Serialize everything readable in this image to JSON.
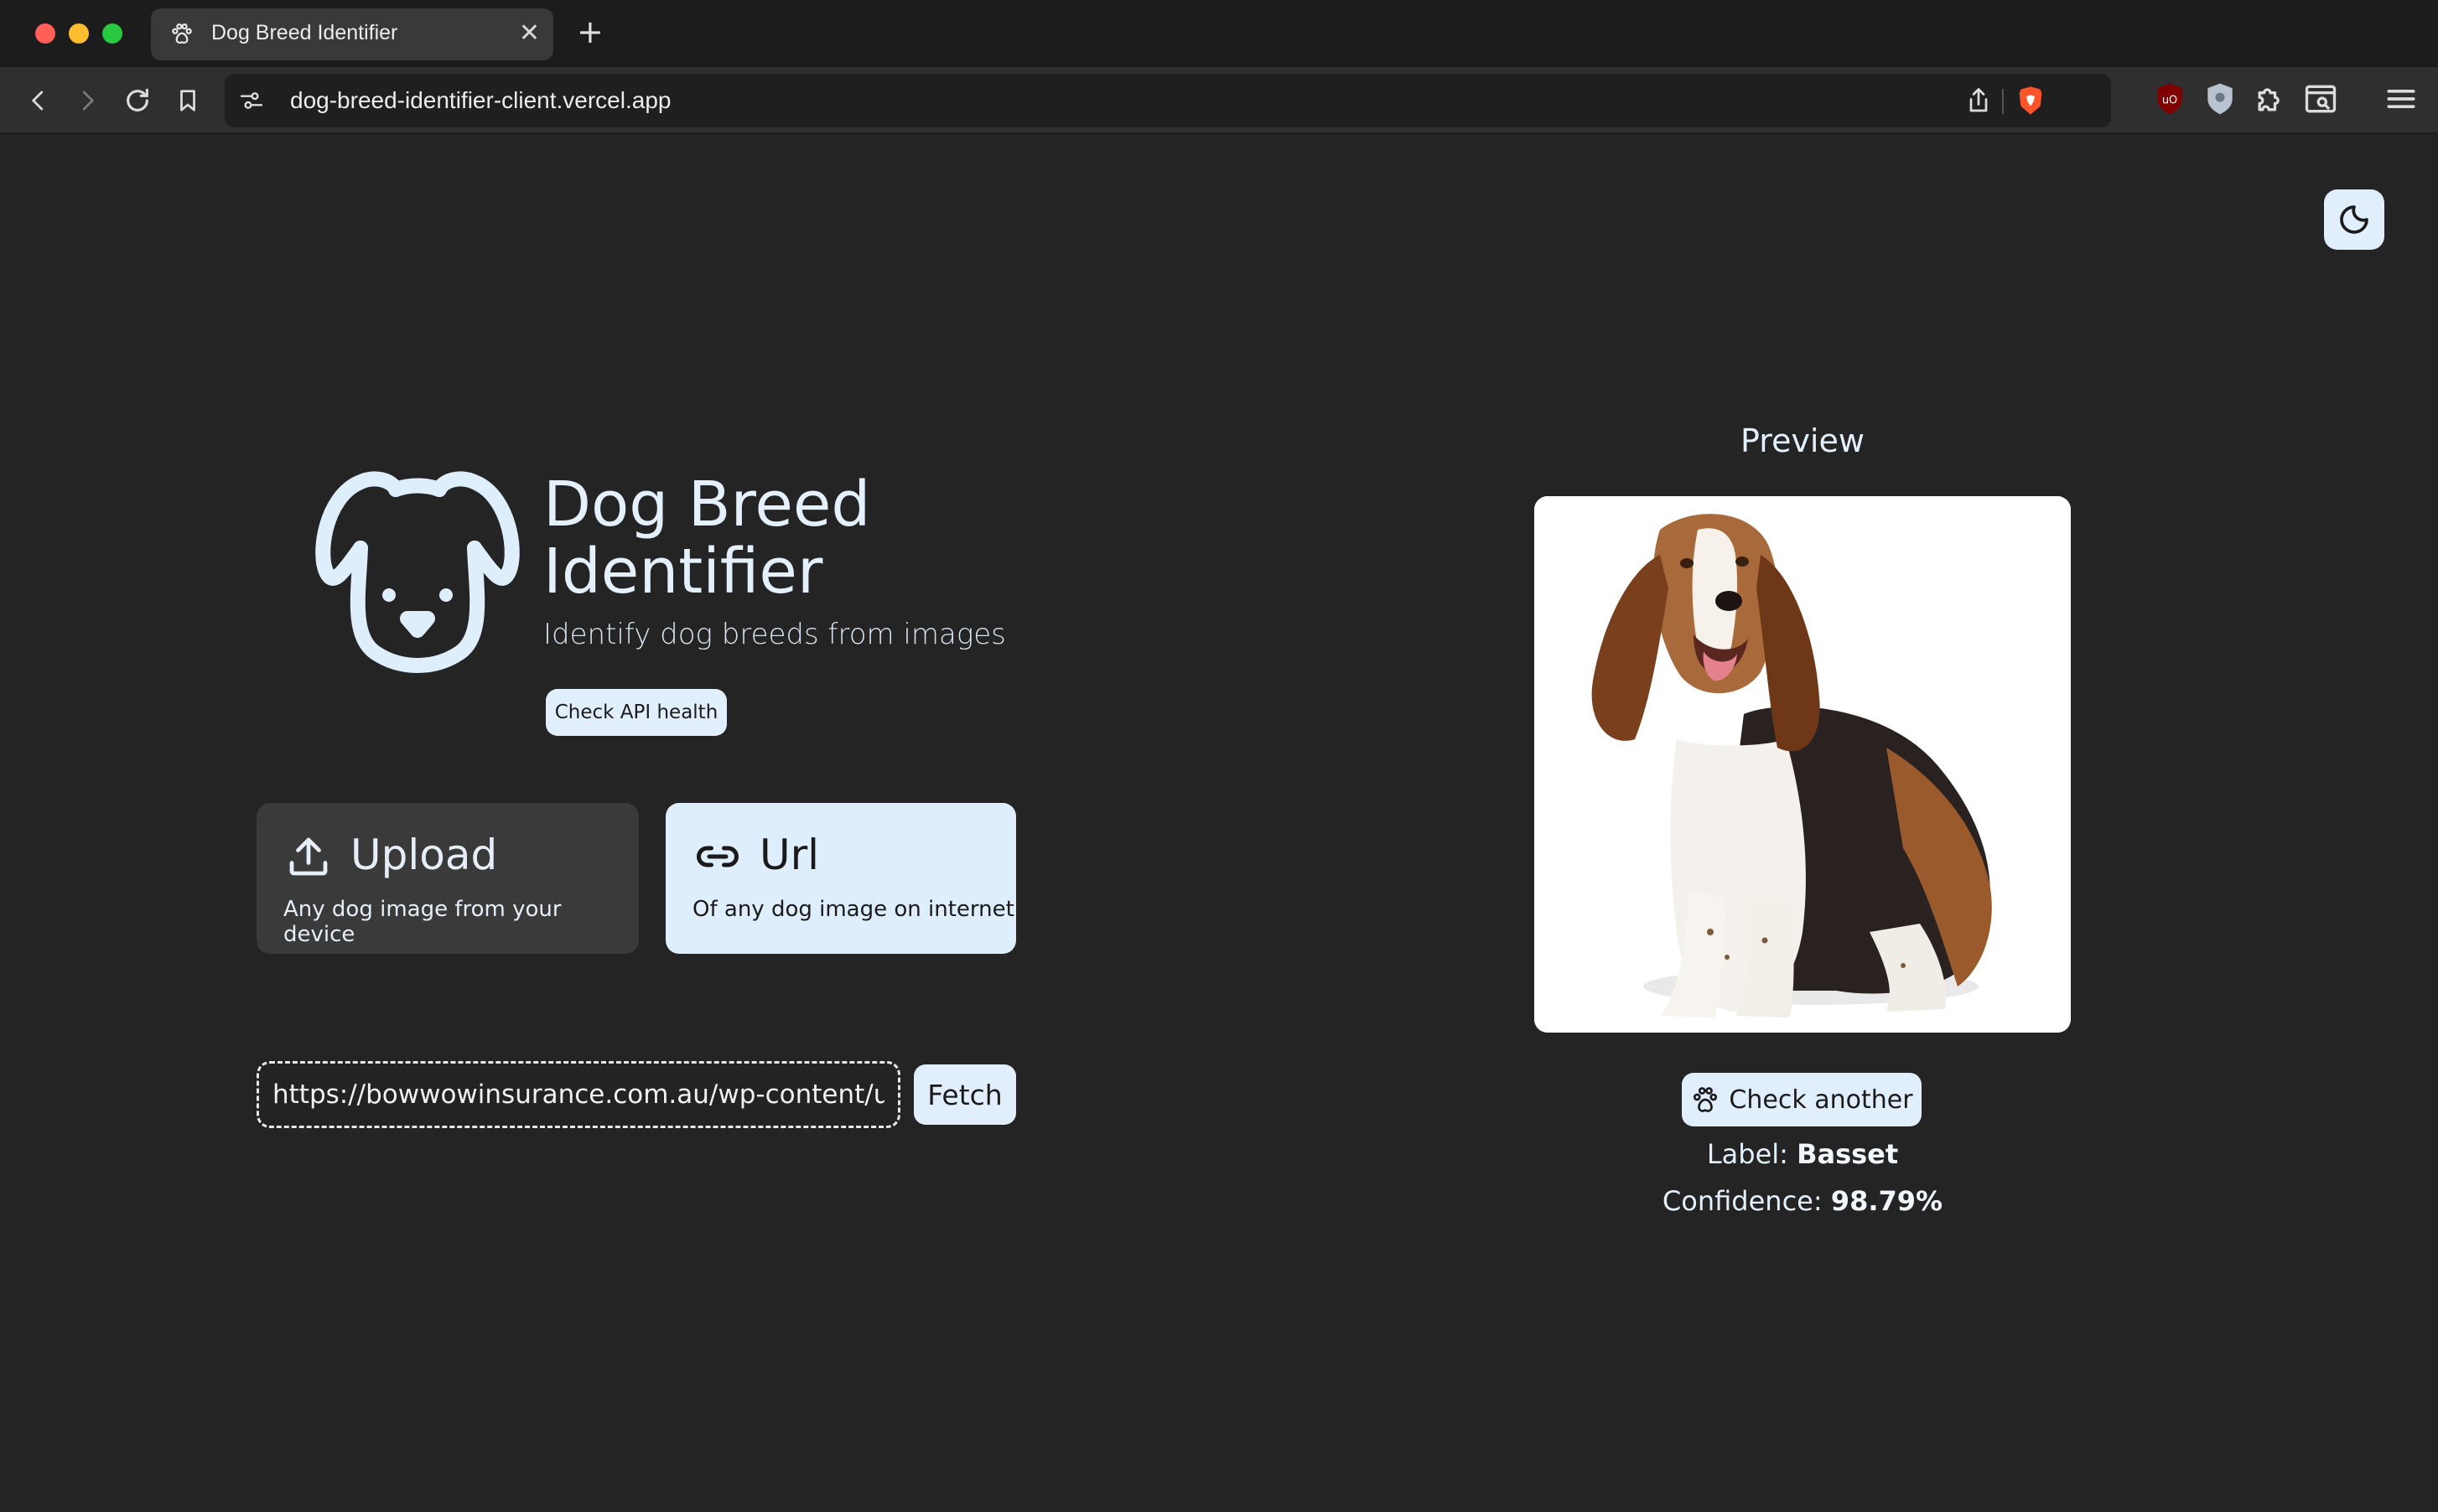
{
  "browser": {
    "tab_title": "Dog Breed Identifier",
    "tab_close": "✕",
    "new_tab": "+",
    "address": "dog-breed-identifier-client.vercel.app"
  },
  "app": {
    "title": "Dog Breed Identifier",
    "subtitle": "Identify dog breeds from images",
    "health_button": "Check API health",
    "modes": [
      {
        "title": "Upload",
        "description": "Any dog image from your device",
        "icon": "upload-icon",
        "selected": false
      },
      {
        "title": "Url",
        "description": "Of any dog image on internet",
        "icon": "link-icon",
        "selected": true
      }
    ],
    "url_input_value": "https://bowwowinsurance.com.au/wp-content/uploads",
    "fetch_button": "Fetch",
    "preview_title": "Preview",
    "check_another_button": "Check another",
    "label_prefix": "Label:",
    "label_value": "Basset",
    "confidence_prefix": "Confidence:",
    "confidence_value": "98.79%"
  },
  "colors": {
    "background": "#242424",
    "accent": "#e1effd",
    "text": "#e4f0fb"
  }
}
